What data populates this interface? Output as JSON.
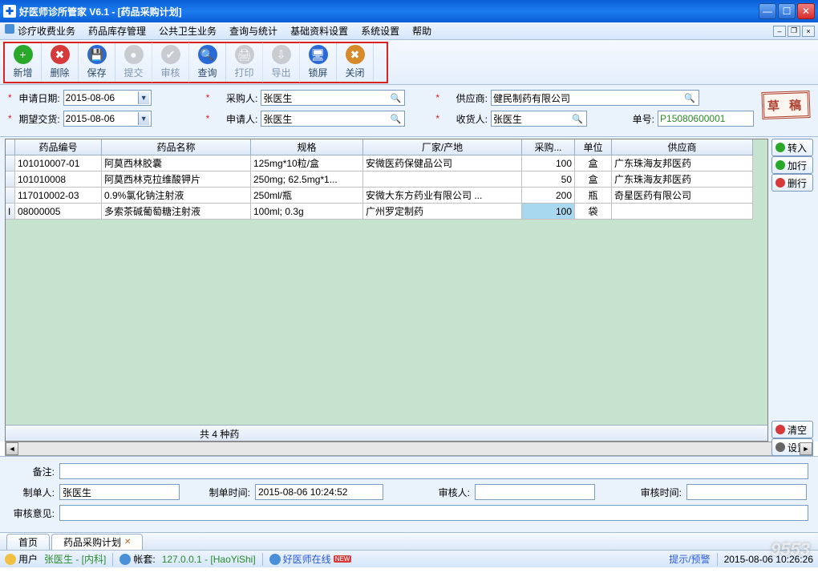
{
  "window": {
    "title": "好医师诊所管家  V6.1 - [药品采购计划]"
  },
  "menu": [
    "诊疗收费业务",
    "药品库存管理",
    "公共卫生业务",
    "查询与统计",
    "基础资料设置",
    "系统设置",
    "帮助"
  ],
  "toolbar": [
    {
      "label": "新增",
      "color": "#2aa82a",
      "glyph": "+",
      "enabled": true
    },
    {
      "label": "删除",
      "color": "#d63a3a",
      "glyph": "✖",
      "enabled": true
    },
    {
      "label": "保存",
      "color": "#2a6ad6",
      "glyph": "💾",
      "enabled": true
    },
    {
      "label": "提交",
      "color": "#aaaaaa",
      "glyph": "●",
      "enabled": false
    },
    {
      "label": "审核",
      "color": "#aaaaaa",
      "glyph": "✔",
      "enabled": false
    },
    {
      "label": "查询",
      "color": "#2a6ad6",
      "glyph": "🔍",
      "enabled": true
    },
    {
      "label": "打印",
      "color": "#aaaaaa",
      "glyph": "🖨",
      "enabled": false
    },
    {
      "label": "导出",
      "color": "#aaaaaa",
      "glyph": "⇩",
      "enabled": false
    },
    {
      "label": "锁屏",
      "color": "#2a6ad6",
      "glyph": "🖥",
      "enabled": true
    },
    {
      "label": "关闭",
      "color": "#d68a2a",
      "glyph": "✖",
      "enabled": true
    }
  ],
  "form": {
    "apply_date_lbl": "申请日期:",
    "apply_date": "2015-08-06",
    "buyer_lbl": "采购人:",
    "buyer": "张医生",
    "supplier_lbl": "供应商:",
    "supplier": "健民制药有限公司",
    "expect_lbl": "期望交货:",
    "expect": "2015-08-06",
    "applicant_lbl": "申请人:",
    "applicant": "张医生",
    "receiver_lbl": "收货人:",
    "receiver": "张医生",
    "orderno_lbl": "单号:",
    "orderno": "P15080600001",
    "stamp": "草 稿"
  },
  "grid": {
    "headers": [
      "药品编号",
      "药品名称",
      "规格",
      "厂家/产地",
      "采购...",
      "单位",
      "供应商"
    ],
    "rows": [
      {
        "code": "101010007-01",
        "name": "阿莫西林胶囊",
        "spec": "125mg*10粒/盒",
        "maker": "安微医药保健品公司",
        "qty": "100",
        "unit": "盒",
        "supplier": "广东珠海友邦医药"
      },
      {
        "code": "101010008",
        "name": "阿莫西林克拉维酸钾片",
        "spec": "250mg; 62.5mg*1...",
        "maker": "",
        "qty": "50",
        "unit": "盒",
        "supplier": "广东珠海友邦医药"
      },
      {
        "code": "117010002-03",
        "name": "0.9%氯化钠注射液",
        "spec": "250ml/瓶",
        "maker": "安微大东方药业有限公司 ...",
        "qty": "200",
        "unit": "瓶",
        "supplier": "奇星医药有限公司"
      },
      {
        "code": "08000005",
        "name": "多索茶碱葡萄糖注射液",
        "spec": "100ml; 0.3g",
        "maker": "广州罗定制药",
        "qty": "100",
        "unit": "袋",
        "supplier": ""
      }
    ],
    "summary": "共  4  种药"
  },
  "side_buttons": [
    {
      "label": "转入",
      "color": "#2aa82a"
    },
    {
      "label": "加行",
      "color": "#2aa82a"
    },
    {
      "label": "删行",
      "color": "#d63a3a"
    }
  ],
  "side_buttons2": [
    {
      "label": "清空",
      "color": "#d63a3a"
    },
    {
      "label": "设置",
      "color": "#666666"
    }
  ],
  "bottom": {
    "remark_lbl": "备注:",
    "remark": "",
    "creator_lbl": "制单人:",
    "creator": "张医生",
    "create_time_lbl": "制单时间:",
    "create_time": "2015-08-06 10:24:52",
    "auditor_lbl": "审核人:",
    "auditor": "",
    "audit_time_lbl": "审核时间:",
    "audit_time": "",
    "opinion_lbl": "审核意见:",
    "opinion": ""
  },
  "tabs": [
    {
      "label": "首页",
      "active": false,
      "closable": false
    },
    {
      "label": "药品采购计划",
      "active": true,
      "closable": true
    }
  ],
  "status": {
    "user_lbl": "用户",
    "user": "张医生 - [内科]",
    "acct_lbl": "帐套:",
    "acct": "127.0.0.1 - [HaoYiShi]",
    "online": "好医师在线",
    "online_badge": "NEW",
    "alert": "提示/预警",
    "time": "2015-08-06 10:26:26"
  },
  "watermark": "9553"
}
